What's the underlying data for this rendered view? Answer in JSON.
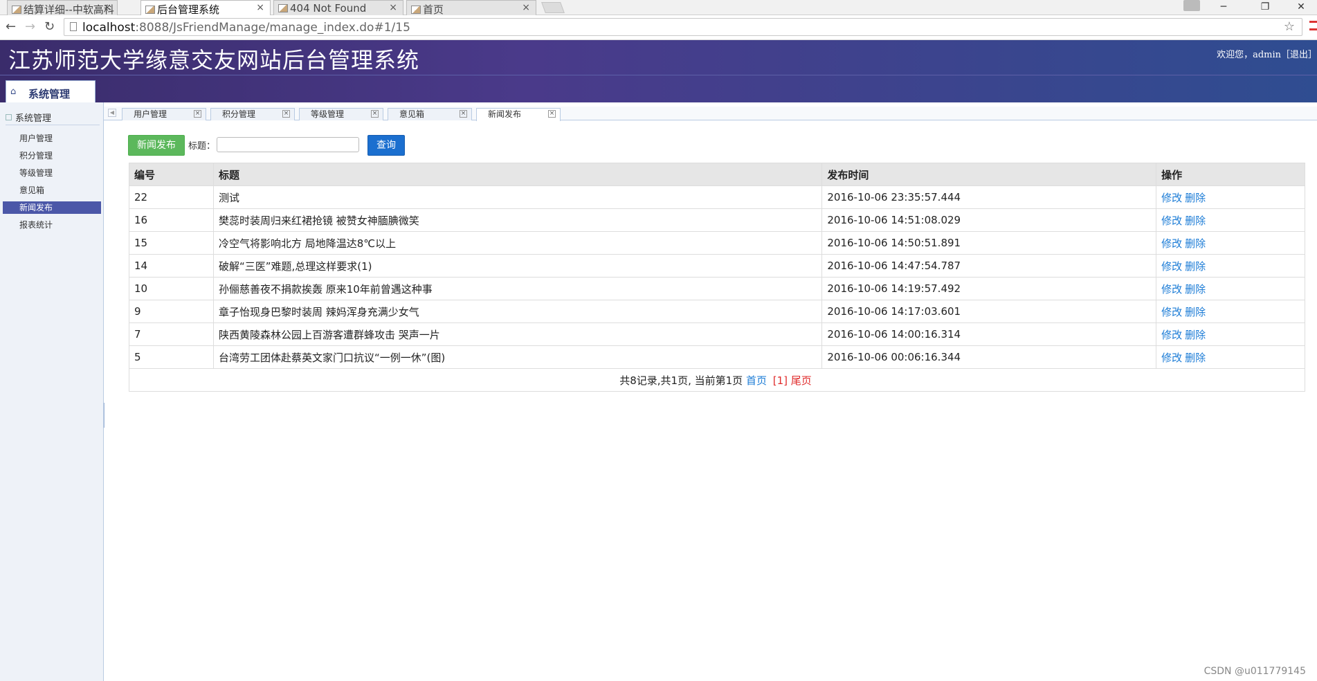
{
  "browser": {
    "tabs": [
      {
        "title": "结算详细--中软高科"
      },
      {
        "title": "后台管理系统",
        "active": true
      },
      {
        "title": "404 Not Found"
      },
      {
        "title": "首页"
      }
    ],
    "url_host": "localhost",
    "url_path": ":8088/JsFriendManage/manage_index.do#1/15"
  },
  "app": {
    "title": "江苏师范大学缘意交友网站后台管理系统",
    "welcome": "欢迎您，admin［退出］",
    "menu_tab": "系统管理"
  },
  "sidebar": {
    "group": "系统管理",
    "items": [
      "用户管理",
      "积分管理",
      "等级管理",
      "意见箱",
      "新闻发布",
      "报表统计"
    ],
    "active_item": "新闻发布"
  },
  "content_tabs": [
    "用户管理",
    "积分管理",
    "等级管理",
    "意见箱",
    "新闻发布"
  ],
  "toolbar": {
    "add_button": "新闻发布",
    "title_label": "标题：",
    "search_value": "",
    "query_button": "查询"
  },
  "table": {
    "headers": [
      "编号",
      "标题",
      "发布时间",
      "操作"
    ],
    "rows": [
      {
        "id": "22",
        "title": "测试",
        "time": "2016-10-06 23:35:57.444"
      },
      {
        "id": "16",
        "title": "樊蕊时装周归来红裙抢镜 被赞女神腼腆微笑",
        "time": "2016-10-06 14:51:08.029"
      },
      {
        "id": "15",
        "title": "冷空气将影响北方 局地降温达8℃以上",
        "time": "2016-10-06 14:50:51.891"
      },
      {
        "id": "14",
        "title": "破解“三医”难题,总理这样要求(1)",
        "time": "2016-10-06 14:47:54.787"
      },
      {
        "id": "10",
        "title": "孙俪慈善夜不捐款挨轰 原来10年前曾遇这种事",
        "time": "2016-10-06 14:19:57.492"
      },
      {
        "id": "9",
        "title": "章子怡现身巴黎时装周 辣妈浑身充满少女气",
        "time": "2016-10-06 14:17:03.601"
      },
      {
        "id": "7",
        "title": "陕西黄陵森林公园上百游客遭群蜂攻击 哭声一片",
        "time": "2016-10-06 14:00:16.314"
      },
      {
        "id": "5",
        "title": "台湾劳工团体赴蔡英文家门口抗议“一例一休”(图)",
        "time": "2016-10-06 00:06:16.344"
      }
    ],
    "edit_label": "修改",
    "delete_label": "删除",
    "pager_text": "共8记录,共1页, 当前第1页",
    "pager_first": "首页",
    "pager_current": "[1]",
    "pager_last": "尾页"
  },
  "watermark": "CSDN @u011779145",
  "colors": {
    "header_start": "#3a2c6b",
    "header_end": "#2f4d91",
    "active_side": "#4b57a8",
    "btn_green": "#5cb85c",
    "btn_blue": "#1b6fcf",
    "link": "#1a7bd6"
  }
}
